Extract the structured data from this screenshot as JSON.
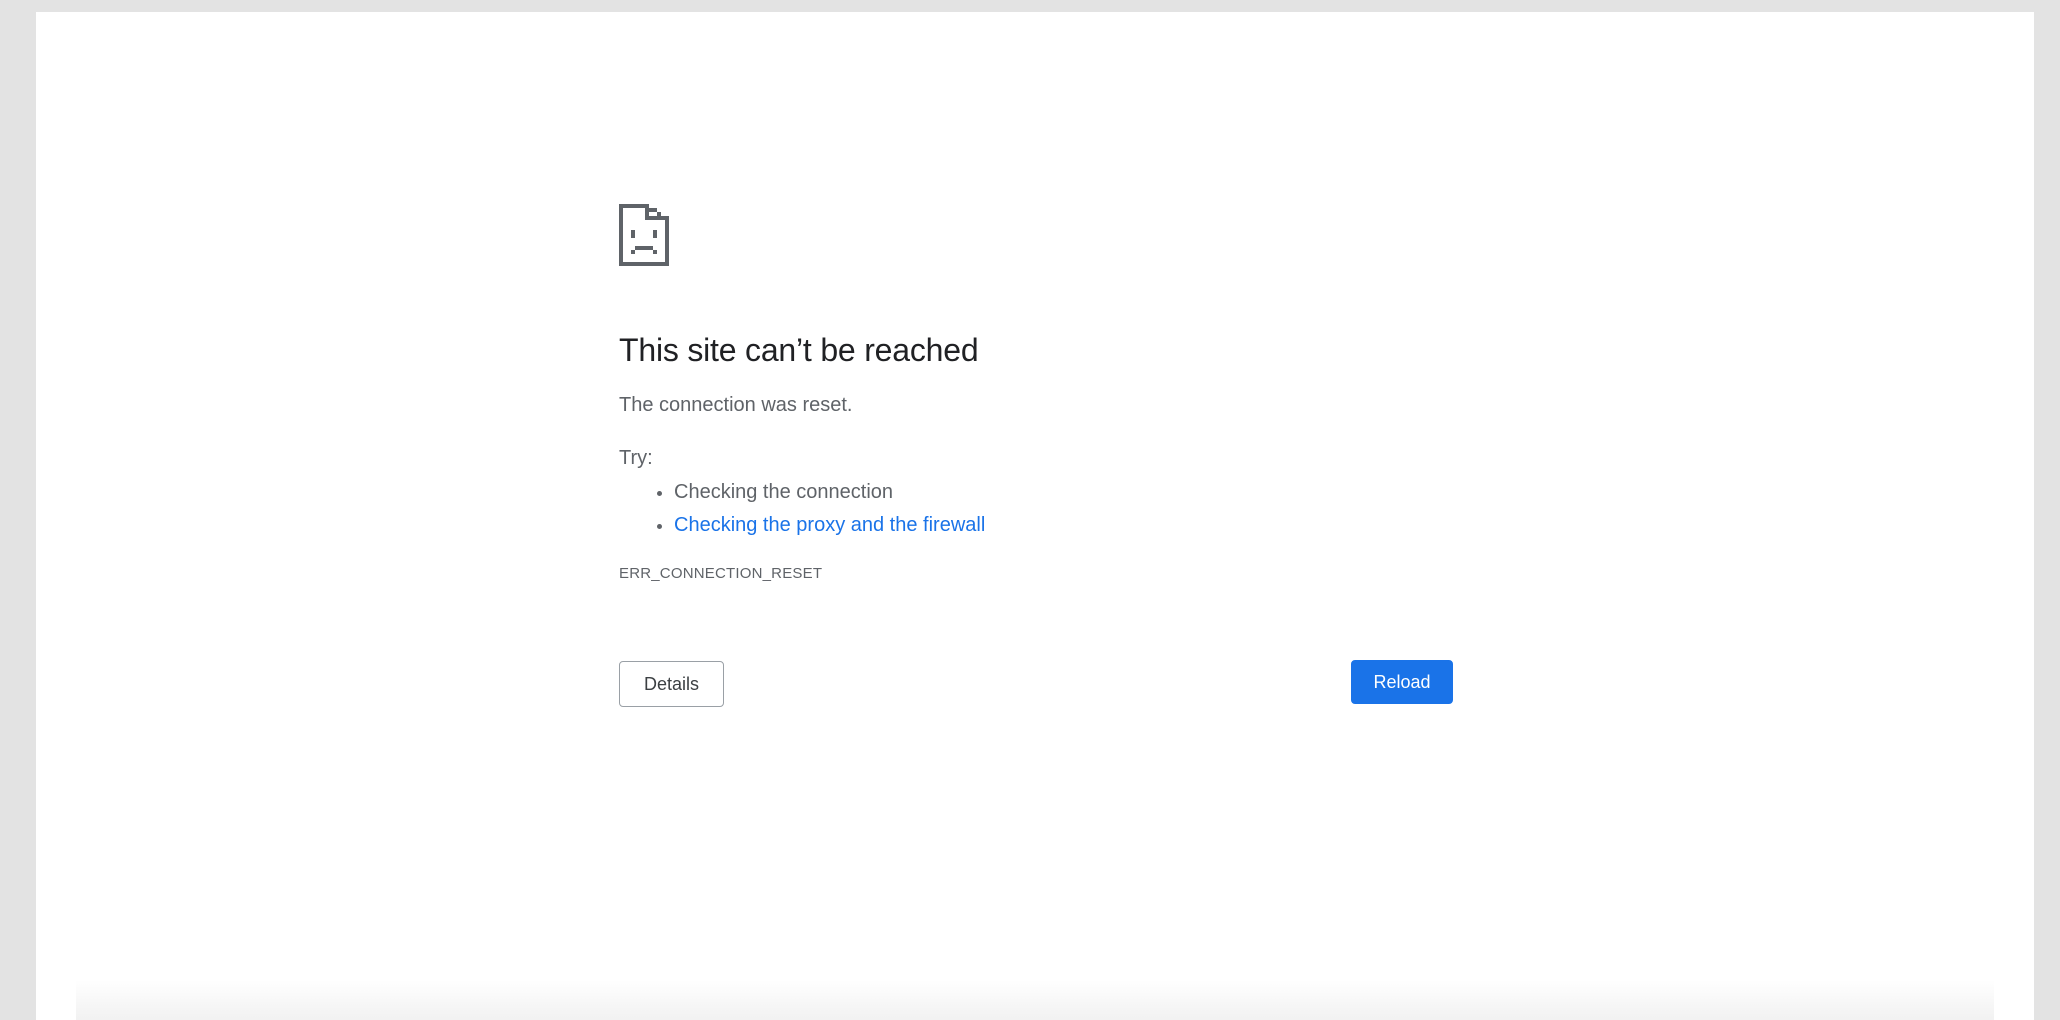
{
  "error_page": {
    "icon": "sad-document-icon",
    "title": "This site can’t be reached",
    "message": "The connection was reset.",
    "try_label": "Try:",
    "suggestions": [
      "Checking the connection",
      "Checking the proxy and the firewall"
    ],
    "error_code": "ERR_CONNECTION_RESET"
  },
  "buttons": {
    "details_label": "Details",
    "reload_label": "Reload"
  },
  "colors": {
    "accent": "#1a73e8",
    "title_text": "#202124",
    "body_text": "#5f6368",
    "page_background": "#e3e3e3"
  }
}
